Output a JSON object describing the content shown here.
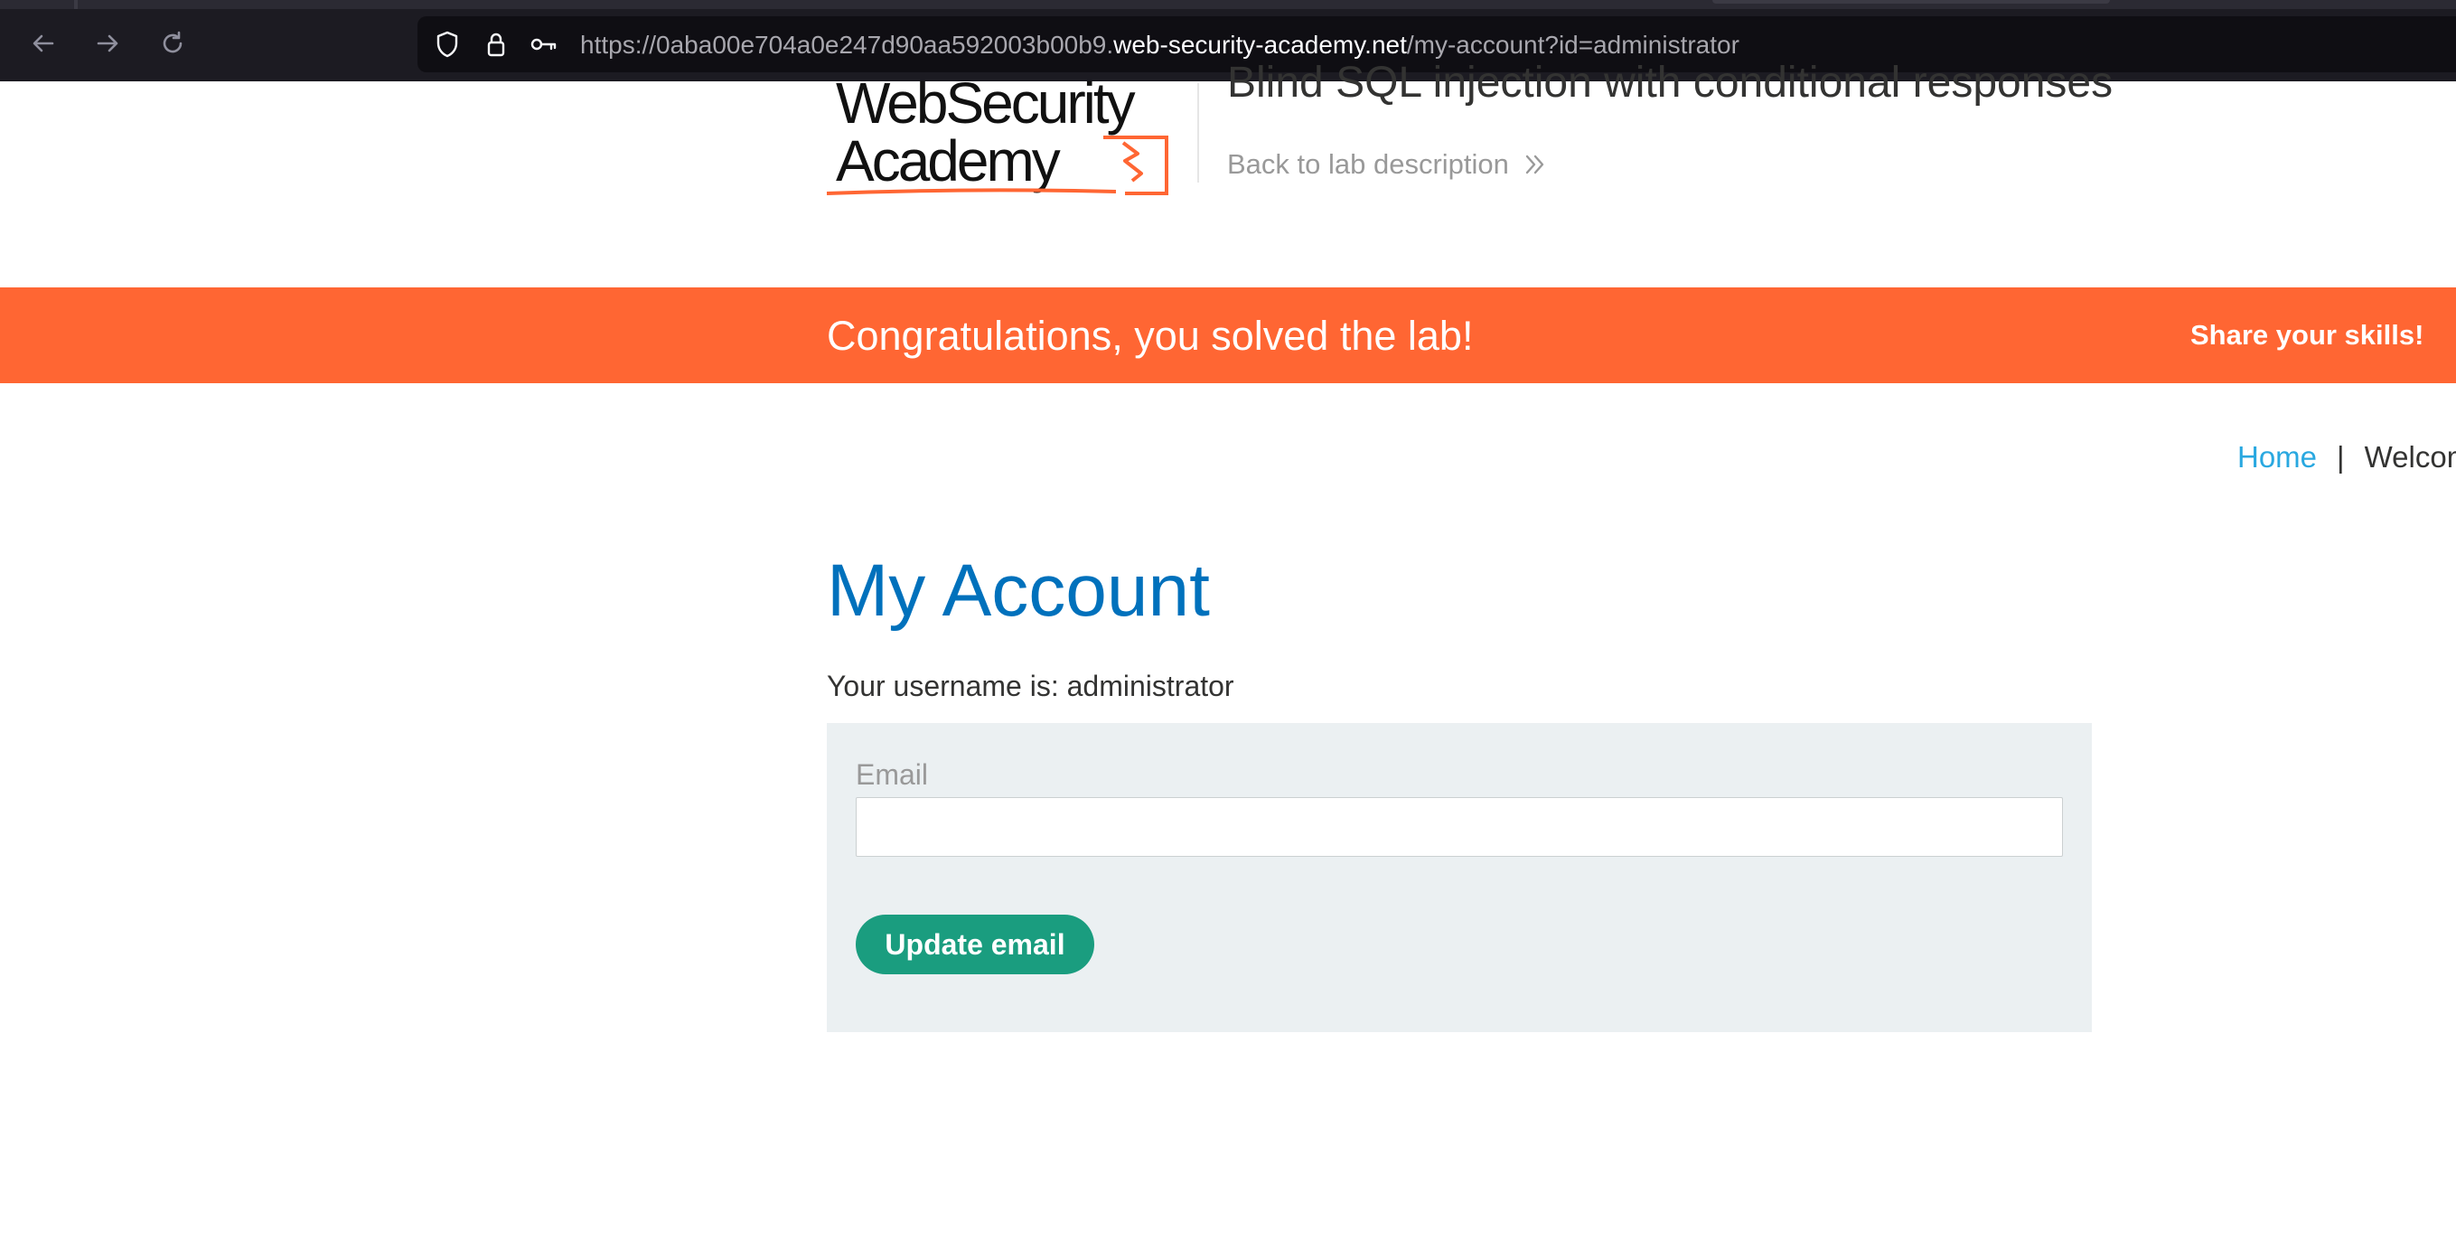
{
  "browser": {
    "url_prefix": "https://0aba00e704a0e247d90aa592003b00b9.",
    "url_domain": "web-security-academy.net",
    "url_path": "/my-account?id=administrator",
    "icons": [
      "back-arrow-icon",
      "forward-arrow-icon",
      "reload-icon",
      "shield-icon",
      "lock-icon",
      "key-icon"
    ]
  },
  "header": {
    "logo_line1": "WebSecurity",
    "logo_line2": "Academy",
    "lab_title": "Blind SQL injection with conditional responses",
    "back_link": "Back to lab description"
  },
  "banner": {
    "message": "Congratulations, you solved the lab!",
    "share": "Share your skills!",
    "color": "#ff6633"
  },
  "nav": {
    "home": "Home",
    "separator": "|",
    "account_partial": "Welcom"
  },
  "main": {
    "title": "My Account",
    "username_line": "Your username is: administrator",
    "email_label": "Email",
    "email_value": "",
    "update_button": "Update email"
  },
  "colors": {
    "title": "#0071bc",
    "link": "#29a8e0",
    "button": "#1a9d7f",
    "form_bg": "#ebf0f2"
  }
}
